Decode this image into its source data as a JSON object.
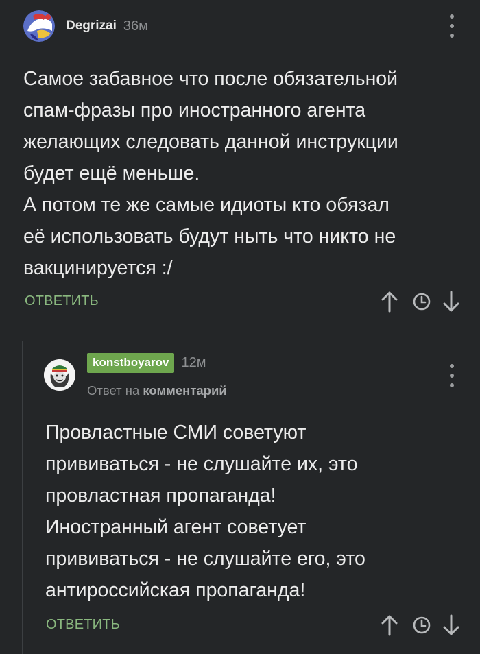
{
  "comments": [
    {
      "author": "Degrizai",
      "time": "36м",
      "lines": [
        "Самое забавное что после обязательной",
        "спам-фразы про иностранного агента",
        "желающих следовать данной инструкции",
        "будет ещё меньше.",
        "А потом те же самые идиоты кто обязал",
        "её использовать будут ныть что никто не",
        "вакцинируется :/"
      ],
      "reply_label": "ОТВЕТИТЬ",
      "icons": [
        "more-icon",
        "arrow-up-icon",
        "clock-icon",
        "arrow-down-icon"
      ]
    },
    {
      "author": "konstboyarov",
      "time": "12м",
      "reply_to_prefix": "Ответ на",
      "reply_to_link": "комментарий",
      "lines": [
        "Провластные СМИ советуют",
        "прививаться - не слушайте их, это",
        "провластная пропаганда!",
        "Иностранный агент советует",
        "прививаться - не слушайте его, это",
        "антироссийская пропаганда!"
      ],
      "reply_label": "ОТВЕТИТЬ",
      "icons": [
        "more-icon",
        "arrow-up-icon",
        "clock-icon",
        "arrow-down-icon"
      ]
    }
  ],
  "colors": {
    "background": "#242628",
    "accent_green": "#8ab87f",
    "badge_green": "#6ea64e",
    "muted": "#8d8f91"
  }
}
